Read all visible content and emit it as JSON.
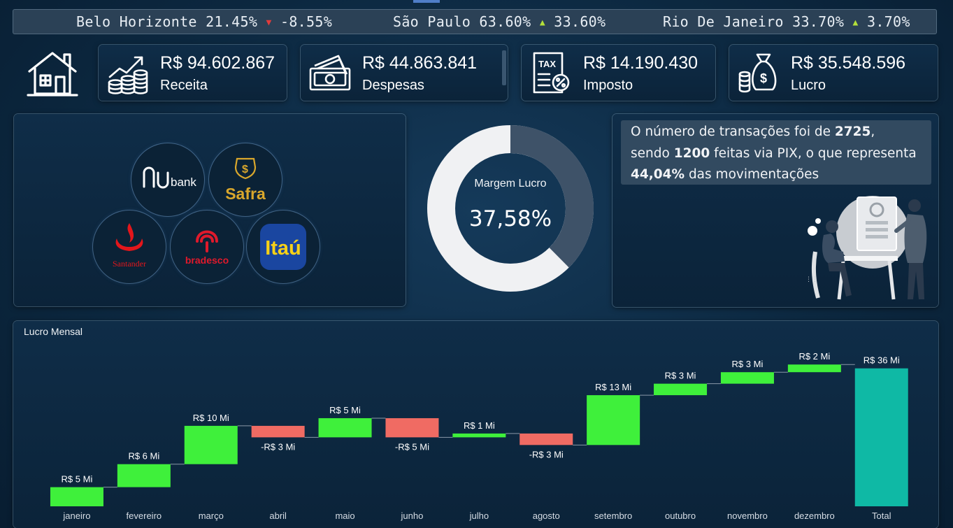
{
  "ticker": [
    {
      "city": "Belo Horizonte",
      "share": "21.45%",
      "trend": "down",
      "change": "-8.55%"
    },
    {
      "city": "São Paulo",
      "share": "63.60%",
      "trend": "up",
      "change": "33.60%"
    },
    {
      "city": "Rio De Janeiro",
      "share": "33.70%",
      "trend": "up",
      "change": "3.70%"
    }
  ],
  "kpis": {
    "receita": {
      "value": "R$ 94.602.867",
      "label": "Receita",
      "icon": "growth-coins-icon"
    },
    "despesas": {
      "value": "R$ 44.863.841",
      "label": "Despesas",
      "icon": "cash-icon"
    },
    "imposto": {
      "value": "R$ 14.190.430",
      "label": "Imposto",
      "icon": "tax-document-icon"
    },
    "lucro": {
      "value": "R$ 35.548.596",
      "label": "Lucro",
      "icon": "money-bag-icon"
    }
  },
  "banks": [
    {
      "name": "nubank",
      "logo_text": "nu",
      "logo_sub": "bank",
      "color": "#ffffff"
    },
    {
      "name": "safra",
      "logo_text": "Safra",
      "color": "#d9a72c"
    },
    {
      "name": "santander",
      "logo_text": "Santander",
      "color": "#e3161b"
    },
    {
      "name": "bradesco",
      "logo_text": "bradesco",
      "color": "#e0192b"
    },
    {
      "name": "itau",
      "logo_text": "Itaú",
      "color": "#f7d117",
      "bg": "#1a46a0"
    }
  ],
  "margin": {
    "label": "Margem Lucro",
    "value": "37,58%",
    "fraction": 0.3758
  },
  "info": {
    "line1_prefix": "O número de transações foi de ",
    "total_transactions": "2725",
    "line1_suffix": ",",
    "line2_prefix": "sendo ",
    "pix_transactions": "1200",
    "line2_suffix": " feitas via PIX, o que representa",
    "pix_percent": "44,04%",
    "line3_suffix": " das movimentações"
  },
  "colors": {
    "increase": "#3ff03b",
    "decrease": "#f06b63",
    "total": "#0fb9a5",
    "panel_border": "#8cb4d2"
  },
  "chart_data": {
    "type": "waterfall",
    "title": "Lucro Mensal",
    "categories": [
      "janeiro",
      "fevereiro",
      "março",
      "abril",
      "maio",
      "junho",
      "julho",
      "agosto",
      "setembro",
      "outubro",
      "novembro",
      "dezembro",
      "Total"
    ],
    "values": [
      5,
      6,
      10,
      -3,
      5,
      -5,
      1,
      -3,
      13,
      3,
      3,
      2,
      36
    ],
    "labels": [
      "R$ 5 Mi",
      "R$ 6 Mi",
      "R$ 10 Mi",
      "-R$ 3 Mi",
      "R$ 5 Mi",
      "-R$ 5 Mi",
      "R$ 1 Mi",
      "-R$ 3 Mi",
      "R$ 13 Mi",
      "R$ 3 Mi",
      "R$ 3 Mi",
      "R$ 2 Mi",
      "R$ 36 Mi"
    ],
    "is_total": [
      false,
      false,
      false,
      false,
      false,
      false,
      false,
      false,
      false,
      false,
      false,
      false,
      true
    ],
    "ylim": [
      0,
      37
    ],
    "grid": false,
    "unit": "R$ Mi"
  }
}
